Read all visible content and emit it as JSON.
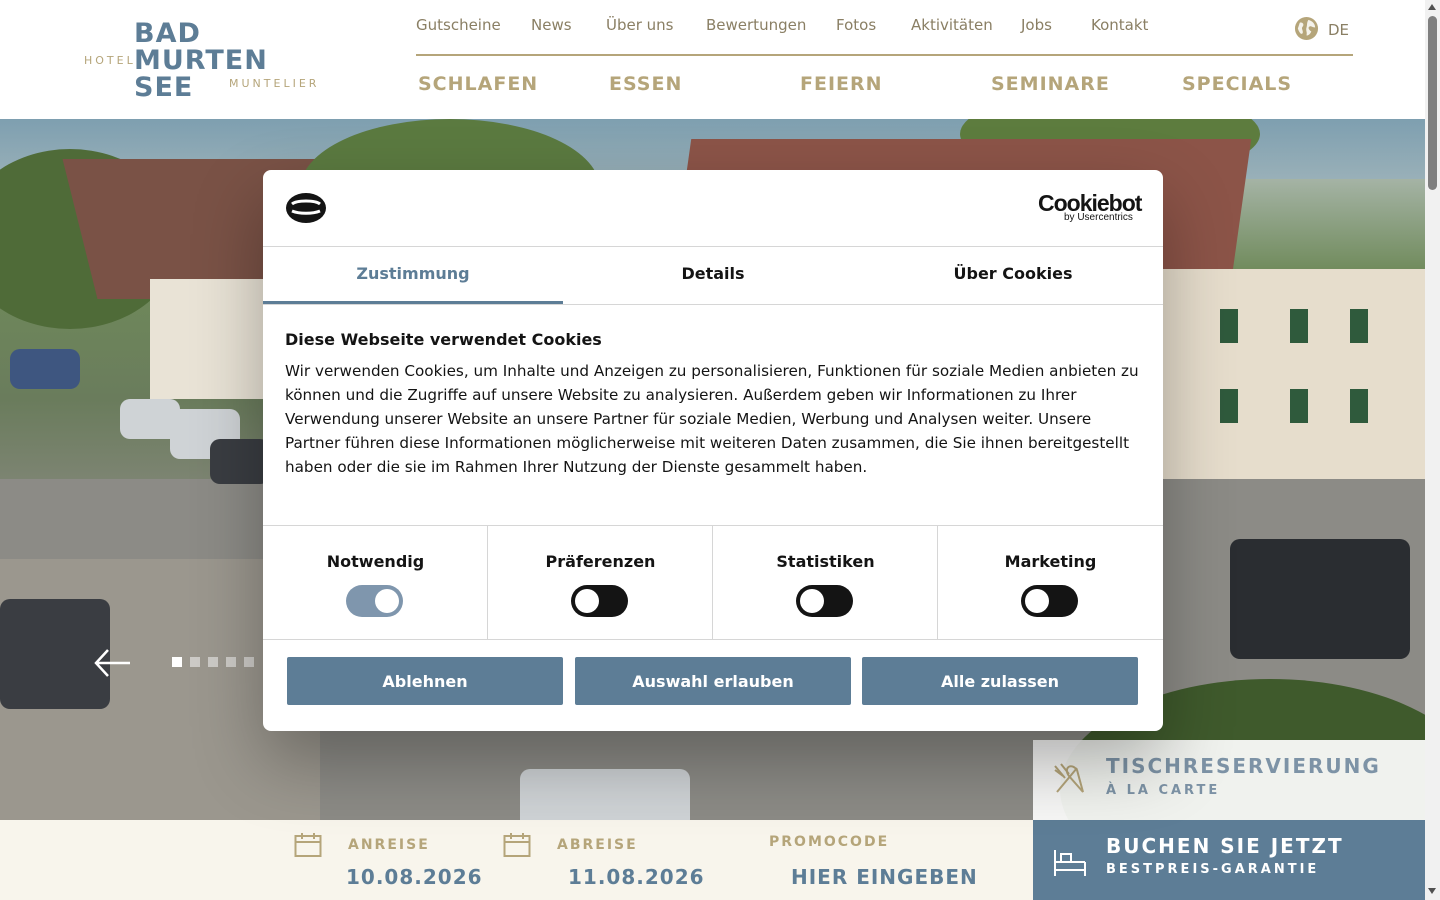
{
  "logo": {
    "hotel": "HOTEL",
    "line1": "BAD",
    "line2": "MURTEN",
    "line3": "SEE",
    "muntelier": "MUNTELIER"
  },
  "topnav": [
    {
      "label": "Gutscheine"
    },
    {
      "label": "News"
    },
    {
      "label": "Über uns"
    },
    {
      "label": "Bewertungen"
    },
    {
      "label": "Fotos"
    },
    {
      "label": "Aktivitäten"
    },
    {
      "label": "Jobs"
    },
    {
      "label": "Kontakt"
    }
  ],
  "language": {
    "code": "DE",
    "icon": "globe-icon"
  },
  "mainnav": [
    {
      "label": "SCHLAFEN"
    },
    {
      "label": "ESSEN"
    },
    {
      "label": "FEIERN"
    },
    {
      "label": "SEMINARE"
    },
    {
      "label": "SPECIALS"
    }
  ],
  "slider": {
    "total_slides": 5,
    "active_slide": 1,
    "prev_icon": "arrow-left-icon"
  },
  "booking": {
    "arrival_label": "ANREISE",
    "arrival_value": "10.08.2026",
    "departure_label": "ABREISE",
    "departure_value": "11.08.2026",
    "promo_label": "PROMOCODE",
    "promo_value": "HIER EINGEBEN"
  },
  "table_reservation": {
    "title": "TISCHRESERVIERUNG",
    "subtitle": "À LA CARTE",
    "icon": "cutlery-icon"
  },
  "book_now": {
    "title": "BUCHEN SIE JETZT",
    "subtitle": "BESTPREIS-GARANTIE",
    "icon": "bed-icon"
  },
  "cookie": {
    "brand": "Cookiebot",
    "brand_sub": "by Usercentrics",
    "tabs": [
      {
        "label": "Zustimmung",
        "active": true
      },
      {
        "label": "Details",
        "active": false
      },
      {
        "label": "Über Cookies",
        "active": false
      }
    ],
    "title": "Diese Webseite verwendet Cookies",
    "text": "Wir verwenden Cookies, um Inhalte und Anzeigen zu personalisieren, Funktionen für soziale Medien anbieten zu können und die Zugriffe auf unsere Website zu analysieren. Außerdem geben wir Informationen zu Ihrer Verwendung unserer Website an unsere Partner für soziale Medien, Werbung und Analysen weiter. Unsere Partner führen diese Informationen möglicherweise mit weiteren Daten zusammen, die Sie ihnen bereitgestellt haben oder die sie im Rahmen Ihrer Nutzung der Dienste gesammelt haben.",
    "categories": [
      {
        "label": "Notwendig",
        "enabled": true
      },
      {
        "label": "Präferenzen",
        "enabled": false
      },
      {
        "label": "Statistiken",
        "enabled": false
      },
      {
        "label": "Marketing",
        "enabled": false
      }
    ],
    "buttons": {
      "decline": "Ablehnen",
      "allow_selection": "Auswahl erlauben",
      "allow_all": "Alle zulassen"
    }
  },
  "colors": {
    "brand_blue": "#5d7d96",
    "brand_gold": "#b5a57a",
    "booking_bg": "#f8f5ec"
  }
}
